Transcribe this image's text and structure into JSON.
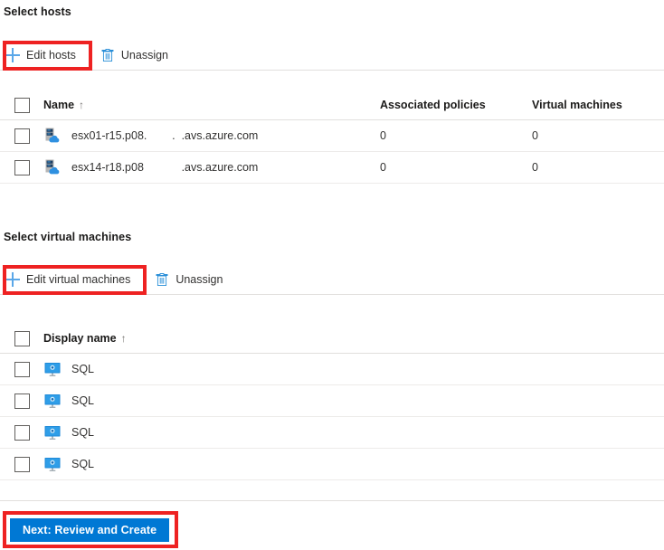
{
  "hosts_section": {
    "heading": "Select hosts",
    "toolbar": {
      "edit_label": "Edit hosts",
      "edit_icon": "plus-icon",
      "unassign_label": "Unassign",
      "unassign_icon": "trash-icon"
    },
    "columns": {
      "name": "Name",
      "sort_indicator": "↑",
      "associated_policies": "Associated policies",
      "virtual_machines": "Virtual machines"
    },
    "rows": [
      {
        "icon": "host-cloud-icon",
        "name": "esx01-r15.p08.        .  .avs.azure.com",
        "associated_policies": "0",
        "virtual_machines": "0"
      },
      {
        "icon": "host-cloud-icon",
        "name": "esx14-r18.p08            .avs.azure.com",
        "associated_policies": "0",
        "virtual_machines": "0"
      }
    ]
  },
  "vms_section": {
    "heading": "Select virtual machines",
    "toolbar": {
      "edit_label": "Edit virtual machines",
      "edit_icon": "plus-icon",
      "unassign_label": "Unassign",
      "unassign_icon": "trash-icon"
    },
    "columns": {
      "display_name": "Display name",
      "sort_indicator": "↑"
    },
    "rows": [
      {
        "icon": "virtual-machine-icon",
        "display_name": "SQL"
      },
      {
        "icon": "virtual-machine-icon",
        "display_name": "SQL"
      },
      {
        "icon": "virtual-machine-icon",
        "display_name": "SQL"
      },
      {
        "icon": "virtual-machine-icon",
        "display_name": "SQL"
      }
    ]
  },
  "footer": {
    "next_label": "Next: Review and Create"
  },
  "colors": {
    "accent_blue": "#0078d4",
    "icon_blue": "#5aa7e8",
    "highlight_red": "#ee2222",
    "text_primary": "#323130",
    "divider": "#e1dfdd"
  }
}
